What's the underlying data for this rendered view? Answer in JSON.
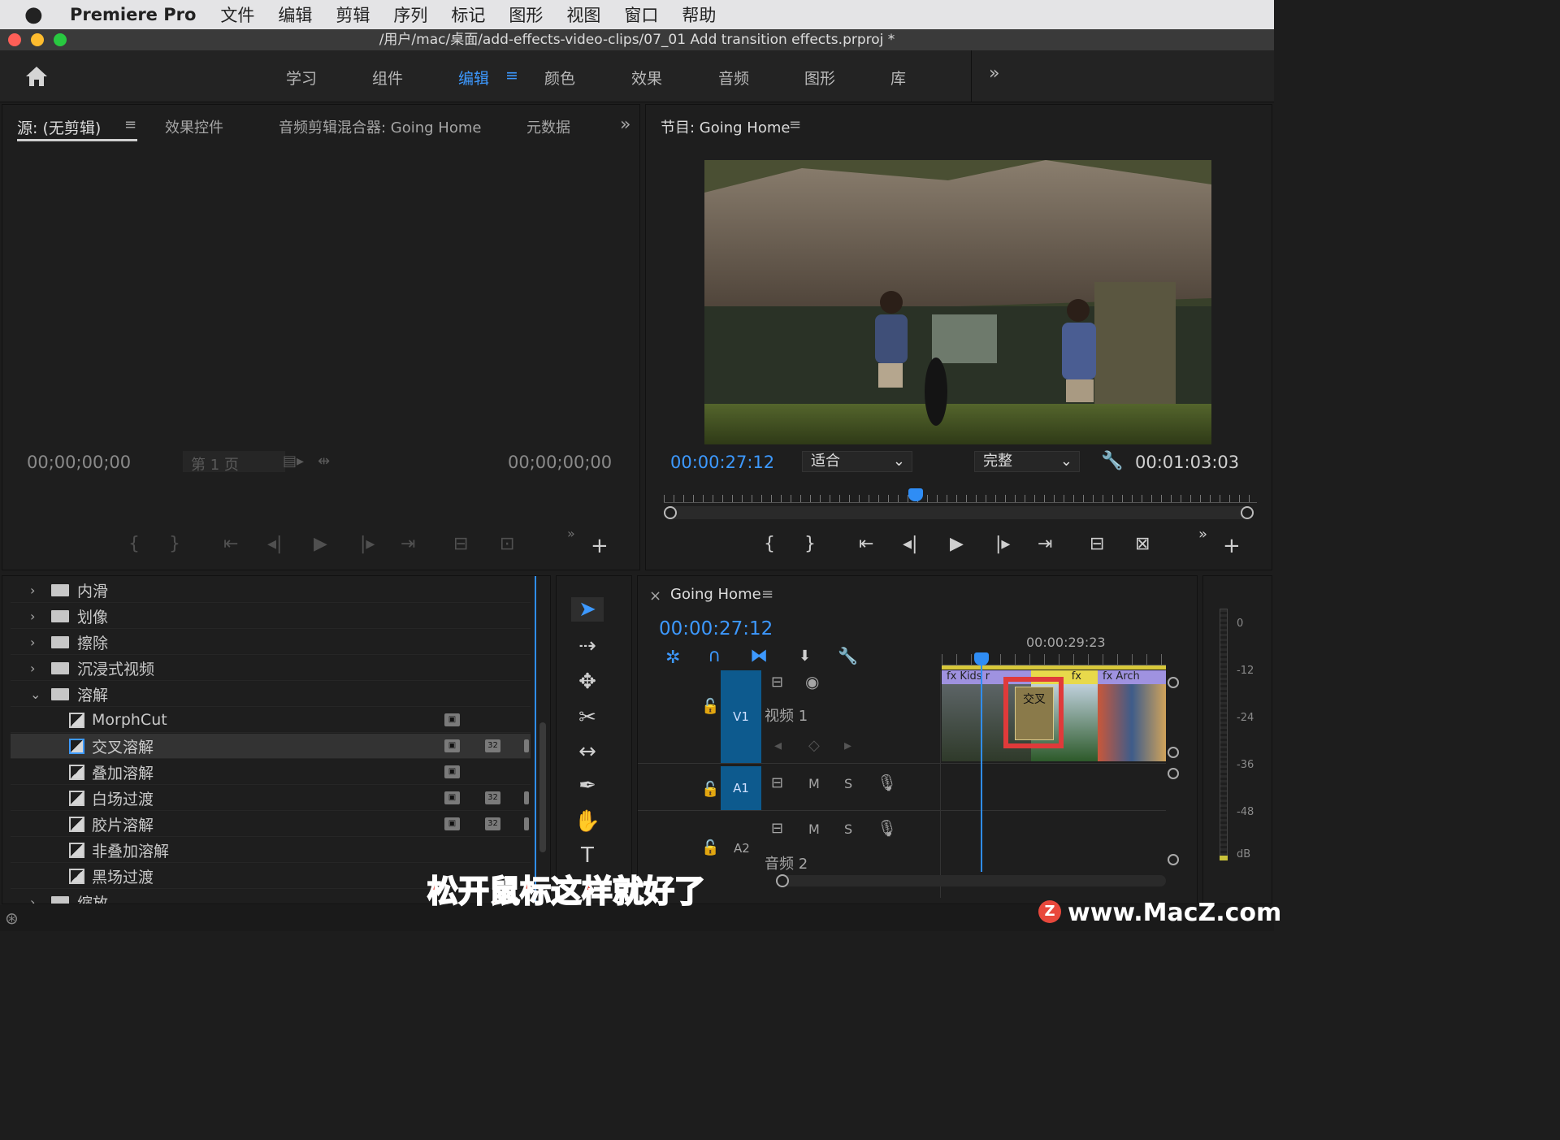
{
  "menubar": {
    "apple": "",
    "app": "Premiere Pro",
    "items": [
      "文件",
      "编辑",
      "剪辑",
      "序列",
      "标记",
      "图形",
      "视图",
      "窗口",
      "帮助"
    ]
  },
  "window": {
    "title": "/用户/mac/桌面/add-effects-video-clips/07_01 Add transition effects.prproj *"
  },
  "workspaces": {
    "items": [
      "学习",
      "组件",
      "编辑",
      "颜色",
      "效果",
      "音频",
      "图形",
      "库"
    ],
    "active": "编辑",
    "more": "»"
  },
  "source": {
    "tabs": [
      "源: (无剪辑)",
      "效果控件",
      "音频剪辑混合器: Going Home",
      "元数据"
    ],
    "more": "»",
    "tc_left": "00;00;00;00",
    "tc_right": "00;00;00;00",
    "page": "第 1 页"
  },
  "program": {
    "title": "节目: Going Home",
    "tc_current": "00:00:27:12",
    "fit": "适合",
    "quality": "完整",
    "tc_duration": "00:01:03:03"
  },
  "effects": {
    "items": [
      {
        "type": "folder",
        "label": "内滑",
        "open": false
      },
      {
        "type": "folder",
        "label": "划像",
        "open": false
      },
      {
        "type": "folder",
        "label": "擦除",
        "open": false
      },
      {
        "type": "folder",
        "label": "沉浸式视频",
        "open": false
      },
      {
        "type": "folder",
        "label": "溶解",
        "open": true
      },
      {
        "type": "effect",
        "label": "MorphCut"
      },
      {
        "type": "effect",
        "label": "交叉溶解",
        "selected": true
      },
      {
        "type": "effect",
        "label": "叠加溶解"
      },
      {
        "type": "effect",
        "label": "白场过渡"
      },
      {
        "type": "effect",
        "label": "胶片溶解"
      },
      {
        "type": "effect",
        "label": "非叠加溶解"
      },
      {
        "type": "effect",
        "label": "黑场过渡"
      },
      {
        "type": "folder",
        "label": "缩放",
        "open": false
      }
    ],
    "badge_32": "32"
  },
  "timeline": {
    "title": "Going Home",
    "tc": "00:00:27:12",
    "ruler_tc": "00:00:29:23",
    "v1": "V1",
    "v1_name": "视频 1",
    "a1": "A1",
    "a2": "A2",
    "a2_name": "音频 2",
    "m": "M",
    "s": "S",
    "clip_kids": "Kids r",
    "clip_arch": "Arch",
    "fx": "fx",
    "transition": "交叉"
  },
  "meter": {
    "labels": [
      "0",
      "-12",
      "-24",
      "-36",
      "-48",
      "dB"
    ]
  },
  "subtitle": "松开鼠标这样就好了",
  "watermark": "www.MacZ.com",
  "colors": {
    "accent": "#2f8df5",
    "clip_video": "#7d6bd0",
    "clip_audio": "#2e7a8a",
    "highlight": "#e03a3a"
  }
}
